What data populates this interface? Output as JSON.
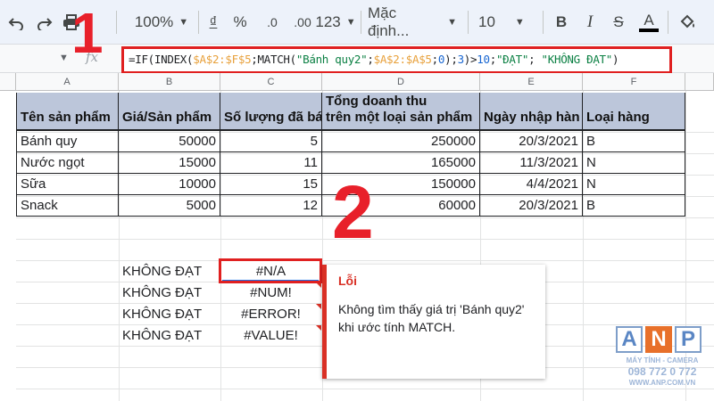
{
  "toolbar": {
    "undo_icon": "undo-icon",
    "redo_icon": "redo-icon",
    "print_icon": "print-icon",
    "paint_format_icon": "paint-format-icon",
    "zoom": "100%",
    "currency_symbol": "₫",
    "percent_symbol": "%",
    "decimal_decrease": ".0",
    "decimal_increase": ".00",
    "more_formats": "123",
    "font_name": "Mặc định...",
    "font_size": "10",
    "bold": "B",
    "italic": "I",
    "strikethrough": "S",
    "text_color": "A",
    "fill_icon": "fill-color-icon"
  },
  "formula_bar": {
    "fx_label": "fx",
    "formula_text": "=IF(INDEX($A$2:$F$5;MATCH(\"Bánh quy2\";$A$2:$A$5;0);3)>10;\"ĐẠT\"; \"KHÔNG ĐẠT\")",
    "formula_parts": {
      "p1": "=IF(INDEX(",
      "p2": "$A$2:$F$5",
      "p3": ";MATCH(",
      "p4": "\"Bánh quy2\"",
      "p5": ";",
      "p6": "$A$2:$A$5",
      "p7": ";",
      "p8": "0",
      "p9": ");",
      "p10": "3",
      "p11": ")>",
      "p12": "10",
      "p13": ";",
      "p14": "\"ĐẠT\"",
      "p15": "; ",
      "p16": "\"KHÔNG ĐẠT\"",
      "p17": ")"
    }
  },
  "annotations": {
    "step1": "1",
    "step2": "2"
  },
  "columns": [
    "A",
    "B",
    "C",
    "D",
    "E",
    "F"
  ],
  "table": {
    "headers": [
      "Tên sản phẩm",
      "Giá/Sản phẩm",
      "Số lượng đã bá",
      "Tổng doanh thu",
      "trên một loại sản phẩm",
      "Ngày nhập hàn",
      "Loại hàng"
    ],
    "rows": [
      [
        "Bánh quy",
        "50000",
        "5",
        "250000",
        "20/3/2021",
        "B"
      ],
      [
        "Nước ngọt",
        "15000",
        "11",
        "165000",
        "11/3/2021",
        "N"
      ],
      [
        "Sữa",
        "10000",
        "15",
        "150000",
        "4/4/2021",
        "N"
      ],
      [
        "Snack",
        "5000",
        "12",
        "60000",
        "20/3/2021",
        "B"
      ]
    ]
  },
  "results": {
    "labels": [
      "KHÔNG ĐẠT",
      "KHÔNG ĐẠT",
      "KHÔNG ĐẠT",
      "KHÔNG ĐẠT"
    ],
    "errors": [
      "#N/A",
      "#NUM!",
      "#ERROR!",
      "#VALUE!"
    ]
  },
  "error_popup": {
    "title": "Lỗi",
    "message": "Không tìm thấy giá trị 'Bánh quy2' khi ước tính MATCH."
  },
  "logo": {
    "letters": [
      "A",
      "N",
      "P"
    ],
    "line1": "MÁY TÍNH - CAMERA",
    "line2": "098 772 0 772",
    "line3": "WWW.ANP.COM.VN"
  },
  "colors": {
    "header_fill": "#bcc6da",
    "error_red": "#d93025",
    "annotation_red": "#e02020",
    "logo_orange": "#e8702a",
    "logo_blue": "#5a86c4"
  }
}
